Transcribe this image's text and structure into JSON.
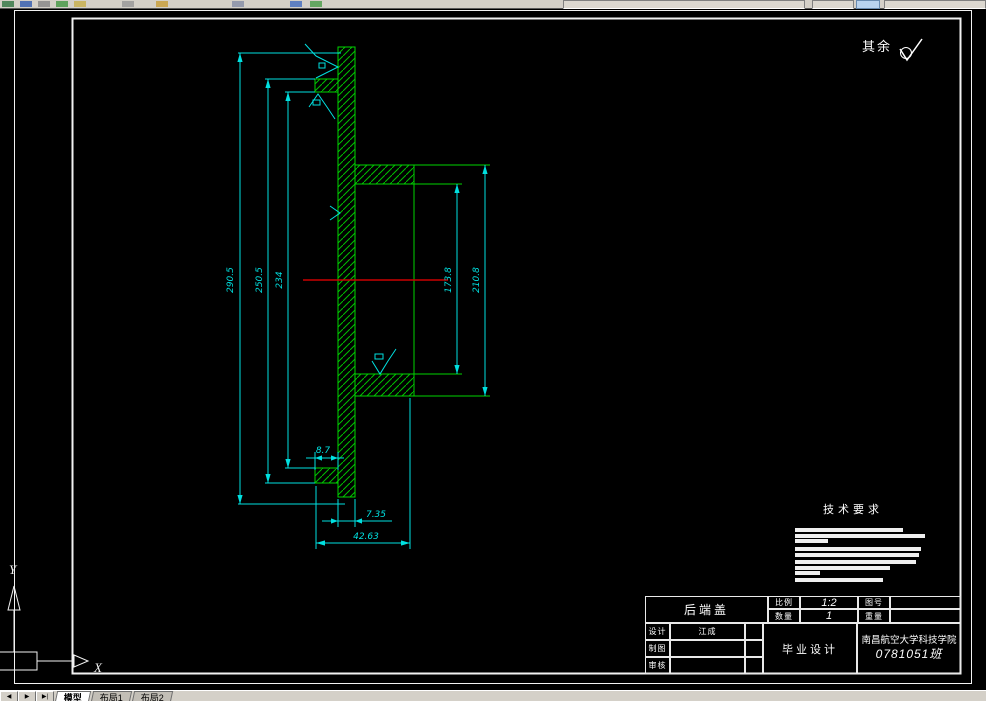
{
  "canvas": {
    "surplus_label": "其余",
    "tech_title": "技术要求",
    "ucs_x": "X",
    "ucs_y": "Y"
  },
  "dims": {
    "overall_height": "290.5",
    "hat_outer": "250.5",
    "hat_inner": "234",
    "bore_dia": "173.8",
    "hub_dia": "210.8",
    "step_width": "8.7",
    "disc_thickness": "7.35",
    "total_depth": "42.63"
  },
  "title_block": {
    "part_name": "后端盖",
    "scale_label": "比例",
    "scale_value": "1:2",
    "qty_label": "数量",
    "qty_value": "1",
    "drawing_no_label": "图号",
    "drawing_no_value": "",
    "weight_label": "重量",
    "weight_value": "",
    "design_label": "设计",
    "designer_name": "江成",
    "draft_label": "制图",
    "check_label": "审核",
    "project_name": "毕业设计",
    "org_name": "南昌航空大学科技学院",
    "class_name": "0781051班"
  },
  "status_bar": {
    "nav": [
      "◀",
      "▶",
      "▶|"
    ],
    "tab_model": "模型",
    "tab_layout1": "布局1",
    "tab_layout2": "布局2"
  },
  "colors": {
    "geometry": "#00d400",
    "dimension": "#00e0e0",
    "centerline": "#cc0000",
    "sheet_frame": "#f2f2f2"
  }
}
